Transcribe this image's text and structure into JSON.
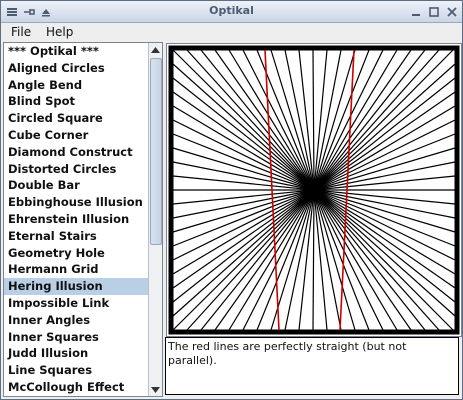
{
  "window": {
    "title": "Optikal"
  },
  "menu": [
    {
      "label": "File"
    },
    {
      "label": "Help"
    }
  ],
  "list": {
    "items": [
      "*** Optikal ***",
      "Aligned Circles",
      "Angle Bend",
      "Blind Spot",
      "Circled Square",
      "Cube Corner",
      "Diamond Construct",
      "Distorted Circles",
      "Double Bar",
      "Ebbinghouse Illusion",
      "Ehrenstein Illusion",
      "Eternal Stairs",
      "Geometry Hole",
      "Hermann Grid",
      "Hering Illusion",
      "Impossible Link",
      "Inner Angles",
      "Inner Squares",
      "Judd Illusion",
      "Line Squares",
      "McCollough Effect"
    ],
    "selected_index": 14
  },
  "description": "The red lines are perfectly straight (but not parallel).",
  "colors": {
    "selection": "#b8cfe5",
    "red_lines": "#cc0000",
    "title_text": "#4c5a72"
  }
}
